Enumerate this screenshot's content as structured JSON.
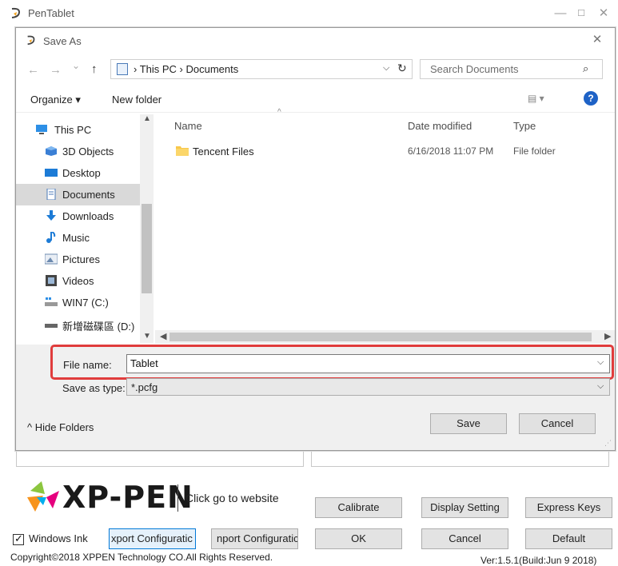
{
  "window": {
    "title": "PenTablet",
    "minimize_label": "—",
    "maximize_label": "☐",
    "close_label": "✕"
  },
  "dialog": {
    "title": "Save As",
    "close_label": "✕",
    "nav": {
      "back": "←",
      "forward": "→",
      "recent": "⌄",
      "up": "↑"
    },
    "address": {
      "path": "› This PC › Documents",
      "dropdown": "⌵",
      "refresh": "↻"
    },
    "search": {
      "placeholder": "Search Documents",
      "icon": "⌕"
    },
    "toolbar": {
      "organize": "Organize ▾",
      "new_folder": "New folder",
      "view": "▤ ▾",
      "help": "?"
    },
    "sidebar": {
      "items": [
        {
          "label": "This PC",
          "icon": "pc-icon"
        },
        {
          "label": "3D Objects",
          "icon": "3d-objects-icon"
        },
        {
          "label": "Desktop",
          "icon": "desktop-icon"
        },
        {
          "label": "Documents",
          "icon": "documents-icon",
          "selected": true
        },
        {
          "label": "Downloads",
          "icon": "downloads-icon"
        },
        {
          "label": "Music",
          "icon": "music-icon"
        },
        {
          "label": "Pictures",
          "icon": "pictures-icon"
        },
        {
          "label": "Videos",
          "icon": "videos-icon"
        },
        {
          "label": "WIN7 (C:)",
          "icon": "drive-c-icon"
        },
        {
          "label": "新增磁碟區 (D:)",
          "icon": "drive-d-icon"
        }
      ]
    },
    "columns": {
      "name": "Name",
      "date_modified": "Date modified",
      "type": "Type"
    },
    "files": [
      {
        "name": "Tencent Files",
        "date_modified": "6/16/2018 11:07 PM",
        "type": "File folder"
      }
    ],
    "file_name": {
      "label": "File name:",
      "value": "Tablet"
    },
    "save_as_type": {
      "label": "Save as type:",
      "value": "*.pcfg"
    },
    "hide_folders": "^ Hide Folders",
    "save_label": "Save",
    "cancel_label": "Cancel"
  },
  "app": {
    "brand": "XP-PEN",
    "website_link": "Click go to website",
    "buttons": {
      "calibrate": "Calibrate",
      "display_setting": "Display Setting",
      "express_keys": "Express Keys",
      "export": "xport Configuratic",
      "import": "nport Configuratic",
      "ok": "OK",
      "cancel": "Cancel",
      "default": "Default"
    },
    "windows_ink": {
      "label": "Windows Ink",
      "checked": true
    },
    "copyright": "Copyright©2018  XPPEN Technology CO.All Rights Reserved.",
    "version": "Ver:1.5.1(Build:Jun  9 2018)",
    "colors": {
      "highlight": "#e03c3c",
      "accent": "#0078d7",
      "help": "#1e62c6"
    }
  }
}
